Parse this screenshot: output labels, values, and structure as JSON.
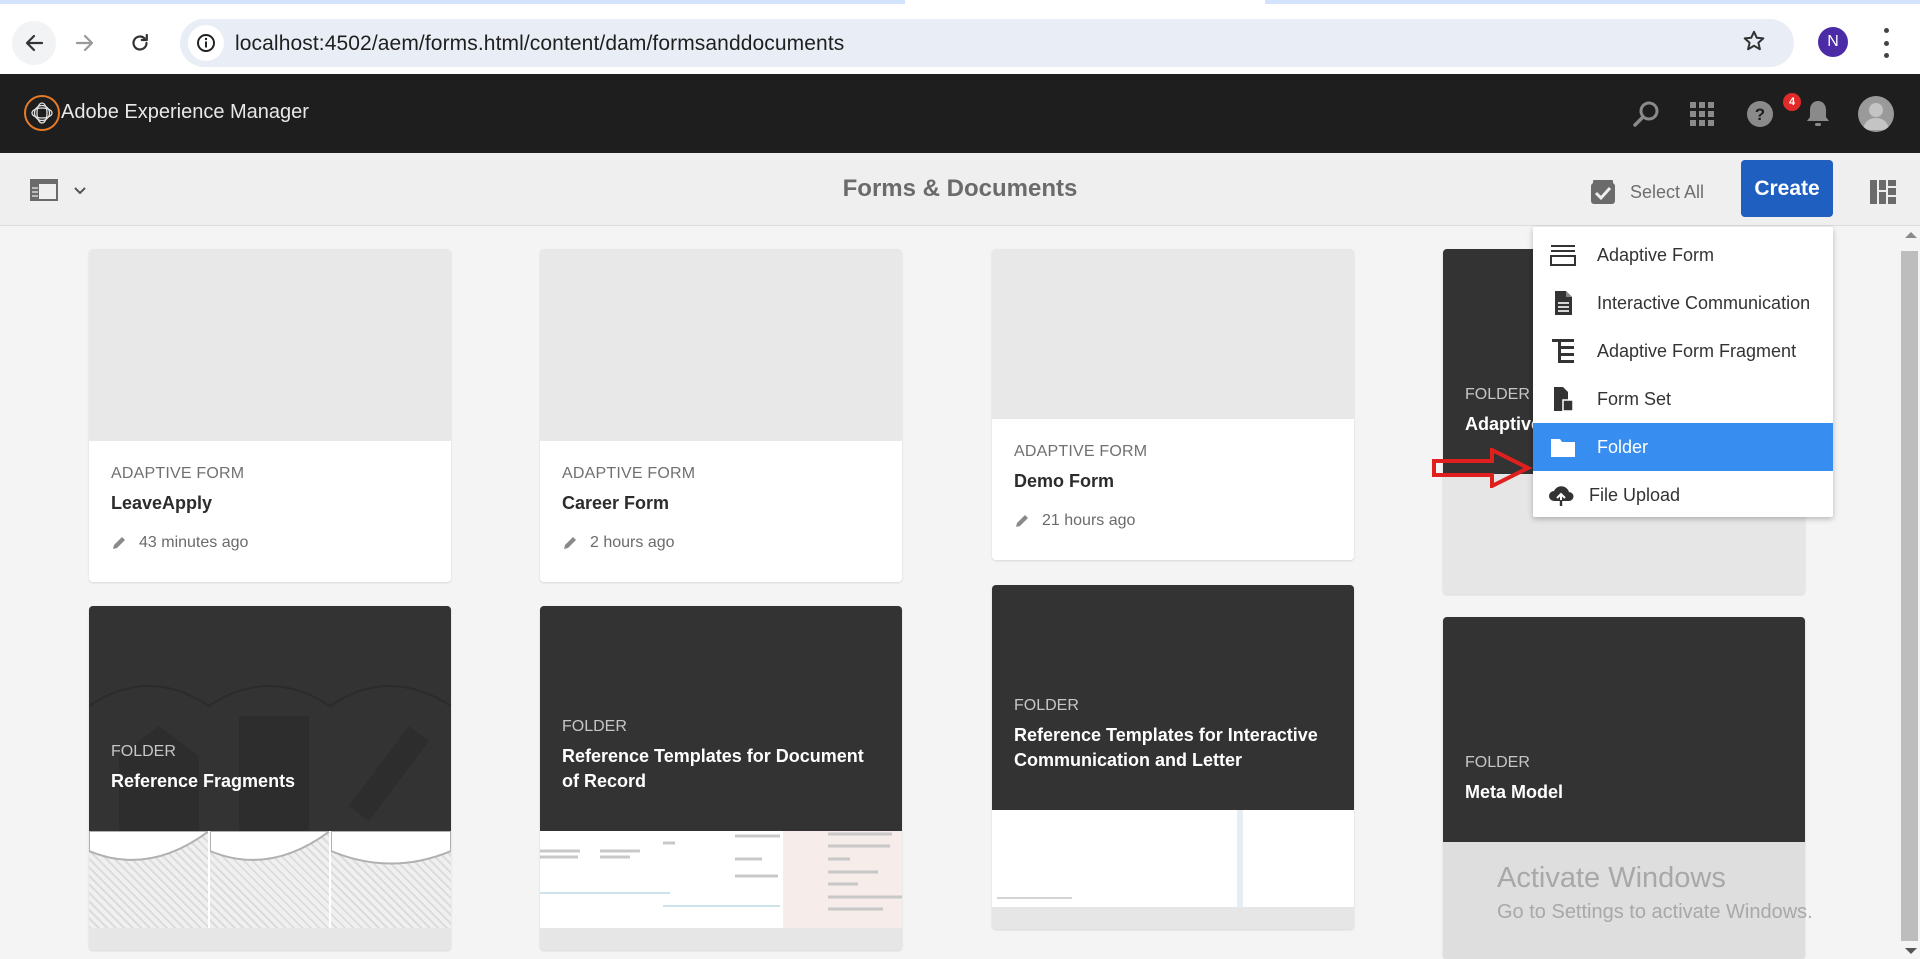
{
  "browser": {
    "url": "localhost:4502/aem/forms.html/content/dam/formsanddocuments",
    "profile_initial": "N",
    "icons": {
      "back": "arrow-left-icon",
      "forward": "arrow-right-icon",
      "reload": "reload-icon",
      "site_info": "info-icon",
      "bookmark": "star-icon",
      "menu": "kebab-menu-icon"
    }
  },
  "shell": {
    "product_name": "Adobe Experience Manager",
    "notification_count": "4",
    "icons": [
      "search-icon",
      "solutions-grid-icon",
      "help-icon",
      "bell-icon",
      "user-avatar-icon"
    ]
  },
  "actionbar": {
    "title": "Forms & Documents",
    "select_all_label": "Select All",
    "create_label": "Create"
  },
  "create_menu": {
    "items": [
      {
        "label": "Adaptive Form",
        "icon": "adaptive-form-icon",
        "active": false
      },
      {
        "label": "Interactive Communication",
        "icon": "document-icon",
        "active": false
      },
      {
        "label": "Adaptive Form Fragment",
        "icon": "fragment-icon",
        "active": false
      },
      {
        "label": "Form Set",
        "icon": "form-set-icon",
        "active": false
      },
      {
        "label": "Folder",
        "icon": "folder-icon",
        "active": true
      },
      {
        "label": "File Upload",
        "icon": "cloud-upload-icon",
        "active": false
      }
    ],
    "colors": {
      "active_bg": "#378ef0"
    }
  },
  "cards": [
    {
      "type": "ADAPTIVE FORM",
      "name": "LeaveApply",
      "modified": "43 minutes ago"
    },
    {
      "type": "ADAPTIVE FORM",
      "name": "Career Form",
      "modified": "2 hours ago"
    },
    {
      "type": "ADAPTIVE FORM",
      "name": "Demo Form",
      "modified": "21 hours ago"
    }
  ],
  "folders": [
    {
      "type": "FOLDER",
      "name": "Adaptive"
    },
    {
      "type": "FOLDER",
      "name": "Reference Fragments"
    },
    {
      "type": "FOLDER",
      "name": "Reference Templates for Document of Record"
    },
    {
      "type": "FOLDER",
      "name": "Reference Templates for Interactive Communication and Letter"
    },
    {
      "type": "FOLDER",
      "name": "Meta Model"
    }
  ],
  "watermark": {
    "title": "Activate Windows",
    "subtitle": "Go to Settings to activate Windows."
  },
  "colors": {
    "brand_blue": "#1f5fbf",
    "shell_bg": "#1e1e1e",
    "aem_logo_ring": "#e57b28",
    "badge_red": "#e12a2a",
    "annotation_red": "#e0201f"
  }
}
